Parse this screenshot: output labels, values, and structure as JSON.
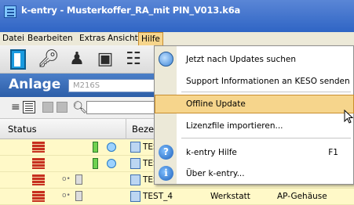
{
  "window": {
    "title": "k-entry - Musterkoffer_RA_mit PIN_V013.k6a"
  },
  "menubar": {
    "items": [
      "Datei",
      "Bearbeiten",
      "Extras",
      "Ansicht",
      "Hilfe"
    ],
    "active": "Hilfe"
  },
  "anlage": {
    "label": "Anlage",
    "value": "M216S"
  },
  "table": {
    "columns": [
      "Status",
      "Beze"
    ],
    "rows": [
      {
        "name": "TES",
        "art": "",
        "typ": ""
      },
      {
        "name": "TES",
        "art": "",
        "typ": ""
      },
      {
        "name": "TES",
        "art": "",
        "typ": ""
      },
      {
        "name": "TEST_4",
        "art": "Werkstatt",
        "typ": "AP-Gehäuse"
      }
    ]
  },
  "help_menu": {
    "items": [
      {
        "label": "Jetzt nach Updates suchen",
        "icon": "update-search-icon"
      },
      {
        "label": "Support Informationen an KESO senden"
      },
      {
        "label": "Offline Update",
        "highlighted": true
      },
      {
        "label": "Lizenzfile importieren..."
      },
      {
        "label": "k-entry Hilfe",
        "shortcut": "F1",
        "icon": "help-icon"
      },
      {
        "label": "Über k-entry...",
        "icon": "info-icon"
      }
    ]
  },
  "colors": {
    "menu_highlight": "#f6d58c",
    "title_bar": "#2e64c4",
    "row_bg": "#fff9c8"
  }
}
